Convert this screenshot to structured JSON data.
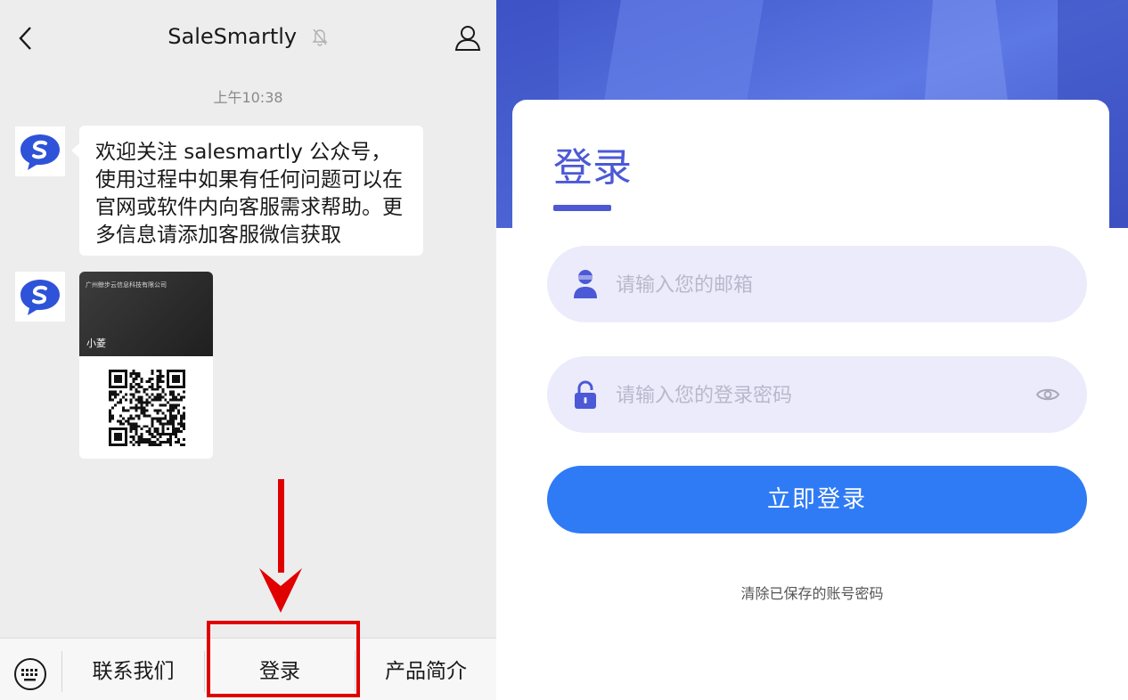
{
  "chat": {
    "title": "SaleSmartly",
    "time": "上午10:38",
    "message": "欢迎关注 salesmartly 公众号，使用过程中如果有任何问题可以在官网或软件内向客服需求帮助。更多信息请添加客服微信获取",
    "card": {
      "company": "广州鲸步云信息科技有限公司",
      "name": "小菱"
    },
    "menu": {
      "contact": "联系我们",
      "login": "登录",
      "product": "产品简介"
    },
    "colors": {
      "highlight": "#e00000",
      "background": "#ededed"
    }
  },
  "login": {
    "title": "登录",
    "email_placeholder": "请输入您的邮箱",
    "password_placeholder": "请输入您的登录密码",
    "submit": "立即登录",
    "clear_saved": "清除已保存的账号密码",
    "colors": {
      "accent": "#4b59d6",
      "button": "#2f7bf6",
      "field": "#ebebfb"
    }
  }
}
